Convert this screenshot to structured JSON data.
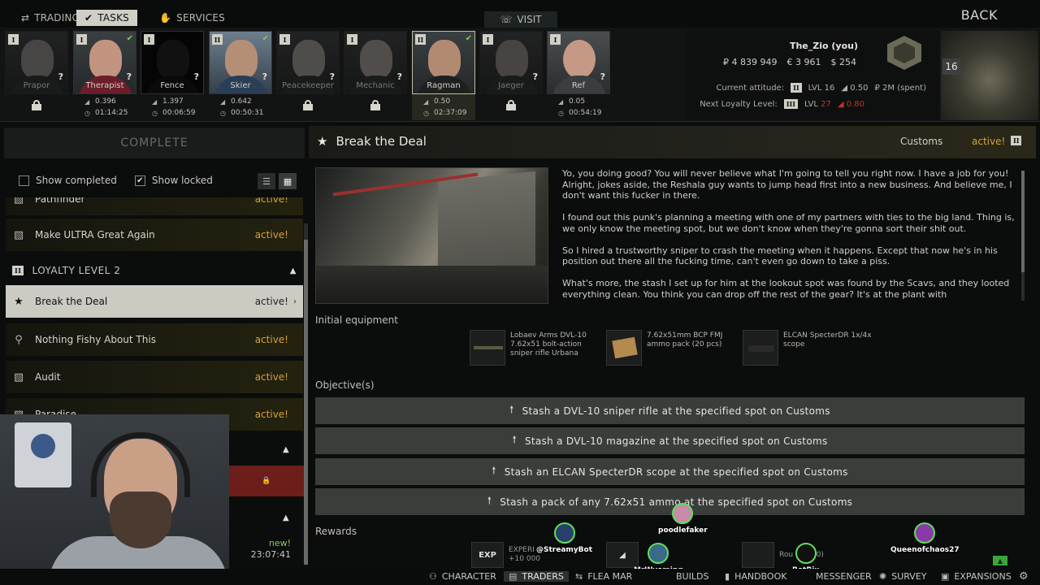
{
  "top_tabs": [
    {
      "label": "TRADING",
      "icon": "trading-icon"
    },
    {
      "label": "TASKS",
      "icon": "tasks-icon"
    },
    {
      "label": "SERVICES",
      "icon": "services-icon"
    }
  ],
  "visit_label": "VISIT",
  "back_label": "BACK",
  "traders": [
    {
      "name": "Prapor",
      "level": "I",
      "locked": true
    },
    {
      "name": "Therapist",
      "level": "I",
      "locked": false,
      "standing": "0.396",
      "timer": "01:14:25"
    },
    {
      "name": "Fence",
      "level": "I",
      "locked": false,
      "standing": "1.397",
      "timer": "00:06:59"
    },
    {
      "name": "Skier",
      "level": "II",
      "locked": false,
      "standing": "0.642",
      "timer": "00:50:31"
    },
    {
      "name": "Peacekeeper",
      "level": "I",
      "locked": true
    },
    {
      "name": "Mechanic",
      "level": "I",
      "locked": true
    },
    {
      "name": "Ragman",
      "level": "II",
      "locked": false,
      "selected": true,
      "standing": "0.50",
      "timer": "02:37:09"
    },
    {
      "name": "Jaeger",
      "level": "I",
      "locked": true
    },
    {
      "name": "Ref",
      "level": "I",
      "locked": false,
      "standing": "0.05",
      "timer": "00:54:19"
    }
  ],
  "player": {
    "name": "The_Zio (you)",
    "roubles": "₽ 4 839 949",
    "euros": "€ 3 961",
    "dollars": "$ 254",
    "current_attitude_label": "Current attitude:",
    "current_rank": "II",
    "current_lvl": "LVL 16",
    "current_standing": "0.50",
    "current_spent": "₽ 2M (spent)",
    "next_loyalty_label": "Next Loyalty Level:",
    "next_rank": "III",
    "next_lvl_label": "LVL",
    "next_lvl": "27",
    "next_standing": "0.80",
    "level": "16"
  },
  "left": {
    "complete_label": "COMPLETE",
    "show_completed": "Show completed",
    "show_locked": "Show locked",
    "quests_top": [
      {
        "name": "Pathfinder",
        "status": "active!",
        "icon": "map-icon"
      },
      {
        "name": "Make ULTRA Great Again",
        "status": "active!",
        "icon": "map-icon"
      }
    ],
    "section_loyalty2": {
      "rank": "II",
      "label": "LOYALTY LEVEL 2"
    },
    "quests_lower": [
      {
        "name": "Break the Deal",
        "status": "active!",
        "icon": "star-icon",
        "selected": true
      },
      {
        "name": "Nothing Fishy About This",
        "status": "active!",
        "icon": "pin-icon"
      },
      {
        "name": "Audit",
        "status": "active!",
        "icon": "map-icon"
      },
      {
        "name": "Paradise",
        "status": "active!",
        "icon": "map-icon"
      }
    ],
    "new_status": "new!",
    "new_timer": "23:07:41"
  },
  "task": {
    "title": "Break the Deal",
    "location": "Customs",
    "status": "active!",
    "rank": "II",
    "description": [
      "Yo, you doing good? You will never believe what I'm going to tell you right now. I have a job for you! Alright, jokes aside, the Reshala guy wants to jump head first into a new business. And believe me, I don't want this fucker in there.",
      "I found out this punk's planning a meeting with one of my partners with ties to the big land. Thing is, we only know the meeting spot, but we don't know when they're gonna sort their shit out.",
      "So I hired a trustworthy sniper to crash the meeting when it happens. Except that now he's in his position out there all the fucking time, can't even go down to take a piss.",
      "What's more, the stash I set up for him at the lookout spot was found by the Scavs, and they looted everything clean. You think you can drop off the rest of the gear? It's at the plant with"
    ],
    "initial_equipment_label": "Initial equipment",
    "equipment": [
      {
        "name": "Lobaev Arms DVL-10 7.62x51 bolt-action sniper rifle Urbana"
      },
      {
        "name": "7.62x51mm BCP FMJ ammo pack (20 pcs)"
      },
      {
        "name": "ELCAN SpecterDR 1x/4x scope"
      }
    ],
    "objectives_label": "Objective(s)",
    "objectives": [
      "Stash a DVL-10 sniper rifle at the specified spot on Customs",
      "Stash a DVL-10 magazine at the specified spot on Customs",
      "Stash an ELCAN SpecterDR scope at the specified spot on Customs",
      "Stash a pack of any 7.62x51 ammo at the specified spot on Customs"
    ],
    "rewards_label": "Rewards",
    "rewards": [
      {
        "thumb": "EXP",
        "line1": "EXPERI",
        "line2": "+10 000"
      },
      {
        "thumb": "",
        "line1": "",
        "line2": ""
      },
      {
        "thumb": "",
        "line1": "Rou",
        "line2": "65 000)"
      }
    ]
  },
  "chat_overlay": [
    {
      "user": "@StreamyBot"
    },
    {
      "user": "poodlefaker"
    },
    {
      "user": "MrWyoming"
    },
    {
      "user": "BotRix"
    },
    {
      "user": "Queenofchaos27"
    }
  ],
  "bottom_bar": [
    {
      "label": "CHARACTER",
      "icon": "character-icon"
    },
    {
      "label": "TRADERS",
      "icon": "traders-icon",
      "active": true
    },
    {
      "label": "FLEA MAR",
      "icon": "flea-market-icon"
    },
    {
      "label": "BUILDS",
      "icon": "builds-icon"
    },
    {
      "label": "HANDBOOK",
      "icon": "handbook-icon"
    },
    {
      "label": "MESSENGER",
      "icon": "messenger-icon"
    },
    {
      "label": "SURVEY",
      "icon": "survey-icon"
    },
    {
      "label": "EXPANSIONS",
      "icon": "expansions-icon"
    }
  ]
}
